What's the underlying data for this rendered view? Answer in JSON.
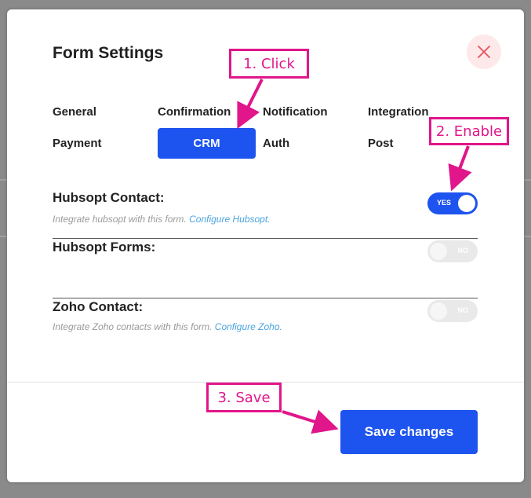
{
  "modal": {
    "title": "Form Settings",
    "close_icon": "close-icon"
  },
  "tabs": [
    {
      "label": "General",
      "active": false
    },
    {
      "label": "Confirmation",
      "active": false
    },
    {
      "label": "Notification",
      "active": false
    },
    {
      "label": "Integration",
      "active": false
    },
    {
      "label": "Payment",
      "active": false
    },
    {
      "label": "CRM",
      "active": true
    },
    {
      "label": "Auth",
      "active": false
    },
    {
      "label": "Post",
      "active": false
    }
  ],
  "integrations": [
    {
      "label": "Hubsopt Contact:",
      "desc": "Integrate hubsopt with this form.",
      "link": "Configure Hubsopt.",
      "enabled": true,
      "toggle_text": "YES"
    },
    {
      "label": "Hubsopt Forms:",
      "desc": "",
      "link": "",
      "enabled": false,
      "toggle_text": "NO"
    },
    {
      "label": "Zoho Contact:",
      "desc": "Integrate Zoho contacts with this form.",
      "link": "Configure Zoho.",
      "enabled": false,
      "toggle_text": "NO"
    }
  ],
  "footer": {
    "save_label": "Save changes"
  },
  "annotations": {
    "step1": "1. Click",
    "step2": "2. Enable",
    "step3": "3. Save"
  },
  "colors": {
    "accent": "#1d53ee",
    "callout": "#e0168a",
    "close_bg": "#fde8ea",
    "close_x": "#e8505b"
  }
}
